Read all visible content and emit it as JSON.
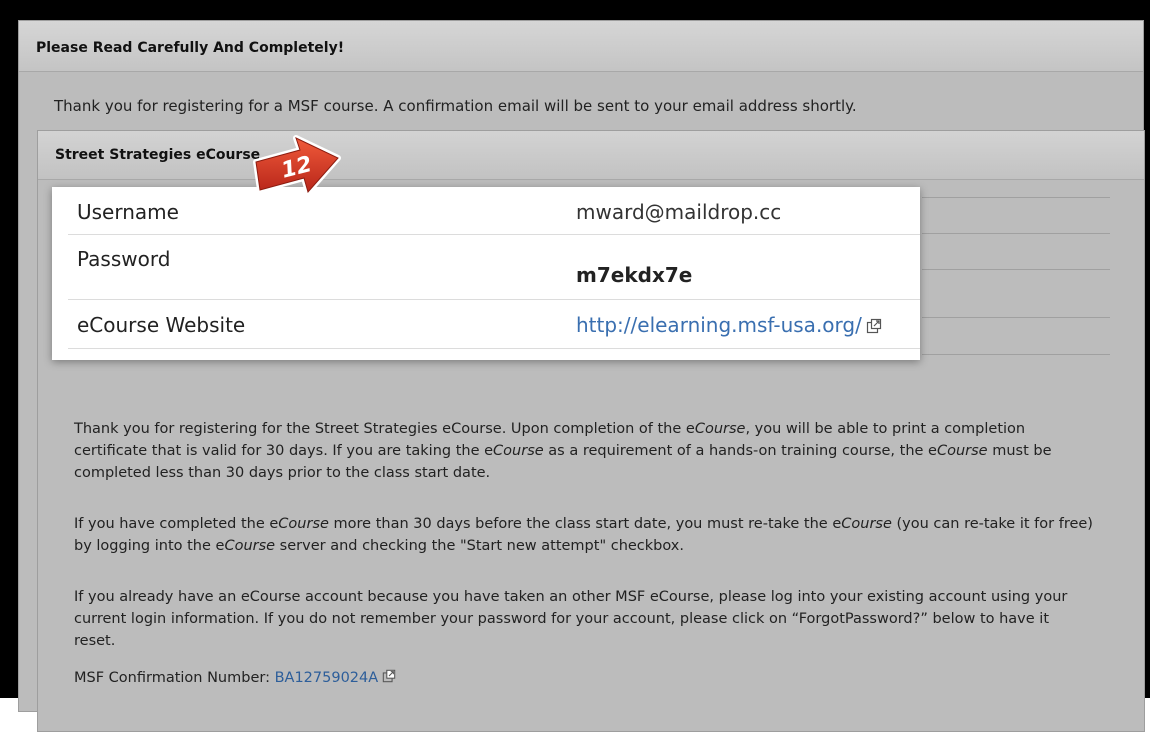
{
  "header": {
    "title": "Please Read Carefully And Completely!"
  },
  "intro": "Thank you for registering for a MSF course. A confirmation email will be sent to your email address shortly.",
  "course": {
    "title": "Street Strategies eCourse"
  },
  "callout": {
    "number": "12"
  },
  "credentials": {
    "username_label": "Username",
    "username_value": "mward@maildrop.cc",
    "password_label": "Password",
    "password_value": "m7ekdx7e",
    "website_label": "eCourse Website",
    "website_value": "http://elearning.msf-usa.org/"
  },
  "paragraphs": {
    "p1": [
      "Thank you for registering for the Street Strategies eCourse. Upon completion of the e",
      "Course",
      ", you will be able to print a completion certificate that is valid for 30 days. If you are taking the e",
      "Course",
      " as a requirement of a hands-on training course, the e",
      "Course",
      " must be completed less than 30 days prior to the class start date."
    ],
    "p2": [
      "If you have completed the e",
      "Course",
      " more than 30 days before the class start date, you must re-take the e",
      "Course",
      " (you can re-take it for free) by logging into the e",
      "Course",
      " server and checking the \"Start new attempt\" checkbox."
    ],
    "p3": "If you already have an eCourse account because you have taken an other MSF eCourse, please log into your existing account using your current login information. If you do not remember your password for your account, please click on “ForgotPassword?” below to have it reset."
  },
  "confirmation": {
    "label": "MSF Confirmation Number:",
    "number": "BA12759024A"
  },
  "icons": {
    "external_link": "external-link-icon",
    "callout": "numbered-arrow-callout"
  },
  "colors": {
    "link": "#3a6fb0",
    "callout_red": "#d63a22",
    "panel_bg": "#bcbcbc"
  }
}
